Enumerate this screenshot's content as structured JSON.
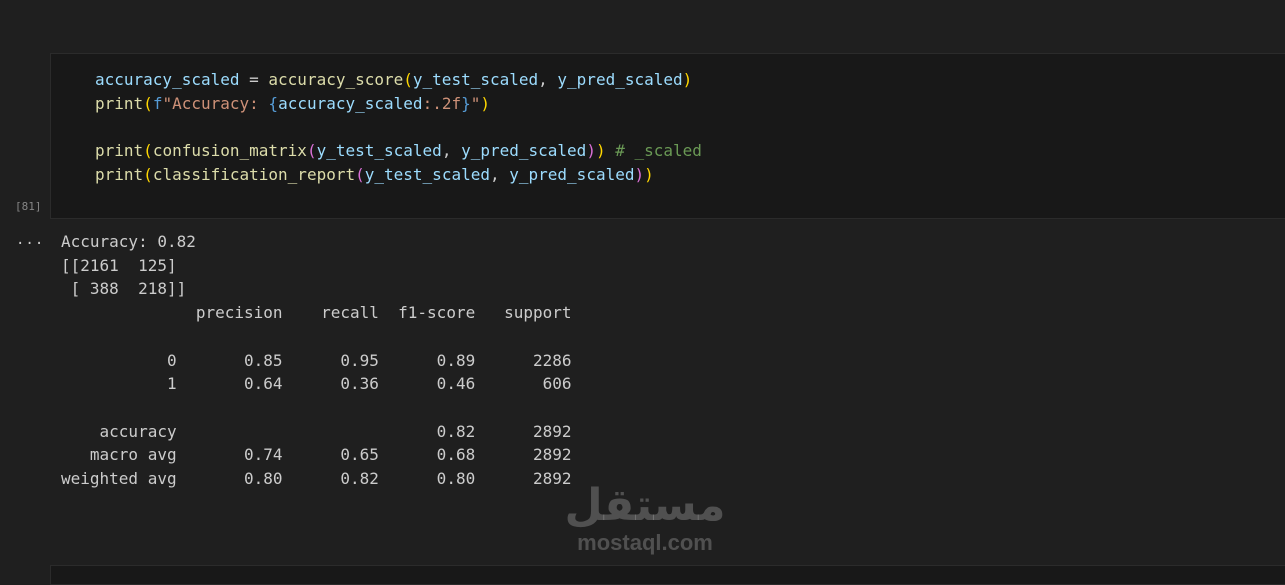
{
  "cell": {
    "execution_count": "[81]",
    "code_lines": [
      [
        {
          "t": "accuracy_scaled",
          "c": "v"
        },
        {
          "t": " = ",
          "c": ""
        },
        {
          "t": "accuracy_score",
          "c": "f"
        },
        {
          "t": "(",
          "c": "p1"
        },
        {
          "t": "y_test_scaled",
          "c": "v"
        },
        {
          "t": ", ",
          "c": ""
        },
        {
          "t": "y_pred_scaled",
          "c": "v"
        },
        {
          "t": ")",
          "c": "p1"
        }
      ],
      [
        {
          "t": "print",
          "c": "f"
        },
        {
          "t": "(",
          "c": "p1"
        },
        {
          "t": "f",
          "c": "k"
        },
        {
          "t": "\"Accuracy: ",
          "c": "s"
        },
        {
          "t": "{",
          "c": "k"
        },
        {
          "t": "accuracy_scaled",
          "c": "v"
        },
        {
          "t": ":.2f",
          "c": "s"
        },
        {
          "t": "}",
          "c": "k"
        },
        {
          "t": "\"",
          "c": "s"
        },
        {
          "t": ")",
          "c": "p1"
        }
      ],
      [],
      [
        {
          "t": "print",
          "c": "f"
        },
        {
          "t": "(",
          "c": "p1"
        },
        {
          "t": "confusion_matrix",
          "c": "f"
        },
        {
          "t": "(",
          "c": "p2"
        },
        {
          "t": "y_test_scaled",
          "c": "v"
        },
        {
          "t": ", ",
          "c": ""
        },
        {
          "t": "y_pred_scaled",
          "c": "v"
        },
        {
          "t": ")",
          "c": "p2"
        },
        {
          "t": ")",
          "c": "p1"
        },
        {
          "t": " ",
          "c": ""
        },
        {
          "t": "# _scaled",
          "c": "c"
        }
      ],
      [
        {
          "t": "print",
          "c": "f"
        },
        {
          "t": "(",
          "c": "p1"
        },
        {
          "t": "classification_report",
          "c": "f"
        },
        {
          "t": "(",
          "c": "p2"
        },
        {
          "t": "y_test_scaled",
          "c": "v"
        },
        {
          "t": ", ",
          "c": ""
        },
        {
          "t": "y_pred_scaled",
          "c": "v"
        },
        {
          "t": ")",
          "c": "p2"
        },
        {
          "t": ")",
          "c": "p1"
        }
      ]
    ]
  },
  "output": {
    "menu_glyph": "...",
    "text": "Accuracy: 0.82\n[[2161  125]\n [ 388  218]]\n              precision    recall  f1-score   support\n\n           0       0.85      0.95      0.89      2286\n           1       0.64      0.36      0.46       606\n\n    accuracy                           0.82      2892\n   macro avg       0.74      0.65      0.68      2892\nweighted avg       0.80      0.82      0.80      2892"
  },
  "watermark": {
    "logo": "مستقل",
    "text": "mostaql.com"
  }
}
